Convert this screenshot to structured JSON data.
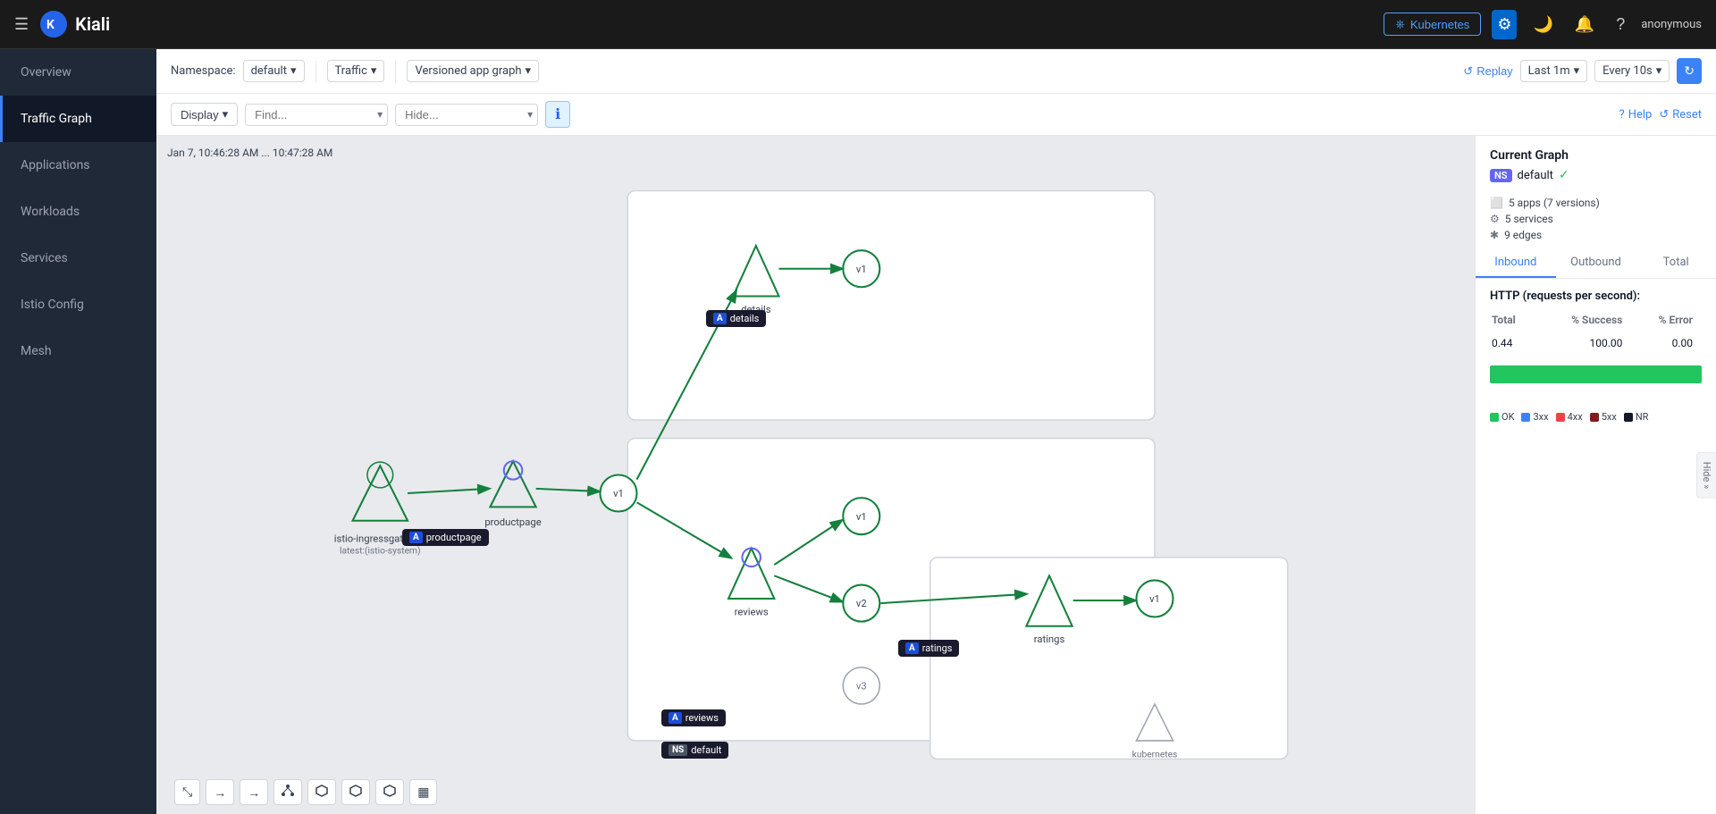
{
  "app": {
    "title": "Kiali",
    "logo_icon": "🔵"
  },
  "topnav": {
    "k8s_label": "Kubernetes",
    "username": "anonymous"
  },
  "sidebar": {
    "items": [
      {
        "id": "overview",
        "label": "Overview"
      },
      {
        "id": "traffic-graph",
        "label": "Traffic Graph",
        "active": true
      },
      {
        "id": "applications",
        "label": "Applications"
      },
      {
        "id": "workloads",
        "label": "Workloads"
      },
      {
        "id": "services",
        "label": "Services"
      },
      {
        "id": "istio-config",
        "label": "Istio Config"
      },
      {
        "id": "mesh",
        "label": "Mesh"
      }
    ]
  },
  "toolbar": {
    "namespace_label": "Namespace:",
    "namespace_value": "default",
    "traffic_label": "Traffic",
    "graph_type_label": "Versioned app graph",
    "replay_label": "Replay",
    "last_label": "Last 1m",
    "every_label": "Every 10s"
  },
  "toolbar2": {
    "display_label": "Display",
    "find_placeholder": "Find...",
    "hide_placeholder": "Hide...",
    "help_label": "Help",
    "reset_label": "Reset"
  },
  "graph": {
    "timestamp": "Jan 7, 10:46:28 AM ... 10:47:28 AM",
    "nodes": [
      {
        "id": "ingressgateway",
        "label": "istio-ingressgateway",
        "sublabel": "latest:(istio-system)",
        "type": "gateway"
      },
      {
        "id": "productpage",
        "label": "productpage",
        "type": "app"
      },
      {
        "id": "details",
        "label": "details",
        "type": "app"
      },
      {
        "id": "reviews",
        "label": "reviews",
        "type": "app"
      },
      {
        "id": "ratings",
        "label": "ratings",
        "type": "app"
      }
    ],
    "app_labels": [
      {
        "id": "details-label",
        "badge": "A",
        "badge_type": "a",
        "text": "details"
      },
      {
        "id": "productpage-label",
        "badge": "A",
        "badge_type": "a",
        "text": "productpage"
      },
      {
        "id": "reviews-label",
        "badge": "A",
        "badge_type": "a",
        "text": "reviews"
      },
      {
        "id": "ratings-label",
        "badge": "A",
        "badge_type": "a",
        "text": "ratings"
      },
      {
        "id": "default-label",
        "badge": "NS",
        "badge_type": "ns",
        "text": "default"
      }
    ]
  },
  "right_panel": {
    "title": "Current Graph",
    "namespace": {
      "badge": "NS",
      "name": "default",
      "status": "✓"
    },
    "stats": [
      {
        "icon": "⬜",
        "text": "5 apps (7 versions)"
      },
      {
        "icon": "⚙",
        "text": "5 services"
      },
      {
        "icon": "✱",
        "text": "9 edges"
      }
    ],
    "tabs": [
      {
        "id": "inbound",
        "label": "Inbound",
        "active": true
      },
      {
        "id": "outbound",
        "label": "Outbound"
      },
      {
        "id": "total",
        "label": "Total"
      }
    ],
    "http_title": "HTTP (requests per second):",
    "table": {
      "headers": [
        "Total",
        "% Success",
        "% Error"
      ],
      "row": [
        "0.44",
        "100.00",
        "0.00"
      ]
    },
    "chart": {
      "ok_pct": 100,
      "labels": [
        "0",
        "25",
        "50",
        "75",
        "100"
      ]
    },
    "legend": [
      {
        "id": "ok",
        "color": "#22c55e",
        "label": "OK"
      },
      {
        "id": "3xx",
        "color": "#3b82f6",
        "label": "3xx"
      },
      {
        "id": "4xx",
        "color": "#ef4444",
        "label": "4xx"
      },
      {
        "id": "5xx",
        "color": "#7f1d1d",
        "label": "5xx"
      },
      {
        "id": "nr",
        "color": "#111827",
        "label": "NR"
      }
    ],
    "hide_label": "Hide",
    "expand_icon": "»"
  },
  "graph_controls": [
    {
      "id": "expand",
      "icon": "⤡"
    },
    {
      "id": "arrow-right1",
      "icon": "→"
    },
    {
      "id": "arrow-right2",
      "icon": "→"
    },
    {
      "id": "layout1",
      "icon": "⬡"
    },
    {
      "id": "layout2",
      "icon": "⬡"
    },
    {
      "id": "layout3",
      "icon": "⬡"
    },
    {
      "id": "layout4",
      "icon": "⬡"
    },
    {
      "id": "chart",
      "icon": "▦"
    }
  ]
}
